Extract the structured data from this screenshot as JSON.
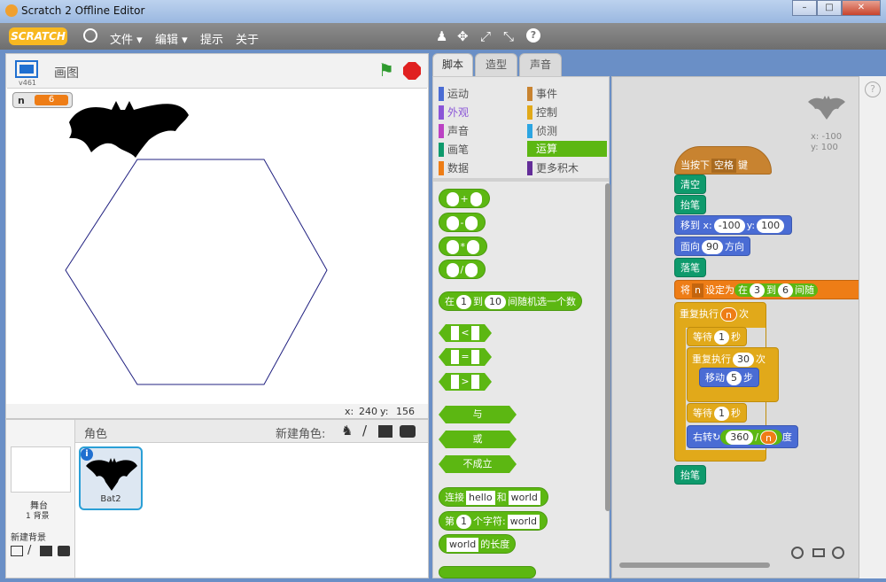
{
  "window": {
    "title": "Scratch 2 Offline Editor",
    "minimize": "–",
    "maximize": "□",
    "close": "✕"
  },
  "menubar": {
    "logo": "SCRATCH",
    "file": "文件 ▾",
    "edit": "编辑 ▾",
    "tips": "提示",
    "about": "关于",
    "icons": [
      "stamp-icon",
      "move-icon",
      "grow-icon",
      "shrink-icon",
      "help-icon"
    ]
  },
  "stage": {
    "project_title": "画图",
    "version": "v461",
    "coords": {
      "x_label": "x:",
      "x": "240",
      "y_label": "y:",
      "y": "156"
    },
    "variable": {
      "name": "n",
      "value": "6"
    }
  },
  "sprites": {
    "header": "角色",
    "new_sprite": "新建角色:",
    "stage_label": "舞台",
    "stage_sub": "1 背景",
    "new_backdrop": "新建背景",
    "items": [
      {
        "name": "Bat2"
      }
    ]
  },
  "tabs": [
    {
      "label": "脚本"
    },
    {
      "label": "造型"
    },
    {
      "label": "声音"
    }
  ],
  "categories": [
    {
      "label": "运动",
      "color": "#4a6cd4"
    },
    {
      "label": "事件",
      "color": "#c88330"
    },
    {
      "label": "外观",
      "color": "#8a55d7"
    },
    {
      "label": "控制",
      "color": "#e1a91a"
    },
    {
      "label": "声音",
      "color": "#bb42c3"
    },
    {
      "label": "侦测",
      "color": "#2ca5e2"
    },
    {
      "label": "画笔",
      "color": "#0e9a6c"
    },
    {
      "label": "运算",
      "color": "#5cb712"
    },
    {
      "label": "数据",
      "color": "#ee7d16"
    },
    {
      "label": "更多积木",
      "color": "#632d99"
    }
  ],
  "palette": {
    "ops": [
      "+",
      "-",
      "*",
      "/"
    ],
    "random": {
      "pre": "在",
      "a": "1",
      "mid": "到",
      "b": "10",
      "post": "间随机选一个数"
    },
    "compare": [
      "<",
      "=",
      ">"
    ],
    "logic": [
      "与",
      "或",
      "不成立"
    ],
    "join": {
      "pre": "连接",
      "a": "hello",
      "mid": "和",
      "b": "world"
    },
    "letter": {
      "pre": "第",
      "a": "1",
      "mid": "个字符:",
      "b": "world"
    },
    "length": {
      "a": "world",
      "post": "的长度"
    }
  },
  "script": {
    "sprite_coords": {
      "x": "x: -100",
      "y": "y: 100"
    },
    "hat": {
      "pre": "当按下",
      "key": "空格",
      "post": "键"
    },
    "clear": "清空",
    "penup1": "抬笔",
    "goto": {
      "pre": "移到 x:",
      "x": "-100",
      "ylab": "y:",
      "y": "100"
    },
    "point": {
      "pre": "面向",
      "dir": "90",
      "post": "方向"
    },
    "pendown": "落笔",
    "setvar": {
      "pre": "将",
      "var": "n",
      "mid": "设定为",
      "rand_pre": "在",
      "a": "3",
      "to": "到",
      "b": "6",
      "rand_post": "间随"
    },
    "repeat1": {
      "pre": "重复执行",
      "var": "n",
      "post": "次"
    },
    "wait1": {
      "pre": "等待",
      "v": "1",
      "post": "秒"
    },
    "repeat2": {
      "pre": "重复执行",
      "v": "30",
      "post": "次"
    },
    "move": {
      "pre": "移动",
      "v": "5",
      "post": "步"
    },
    "wait2": {
      "pre": "等待",
      "v": "1",
      "post": "秒"
    },
    "turn": {
      "pre": "右转",
      "a": "360",
      "op": "/",
      "b": "n",
      "post": "度"
    },
    "penup2": "抬笔"
  }
}
